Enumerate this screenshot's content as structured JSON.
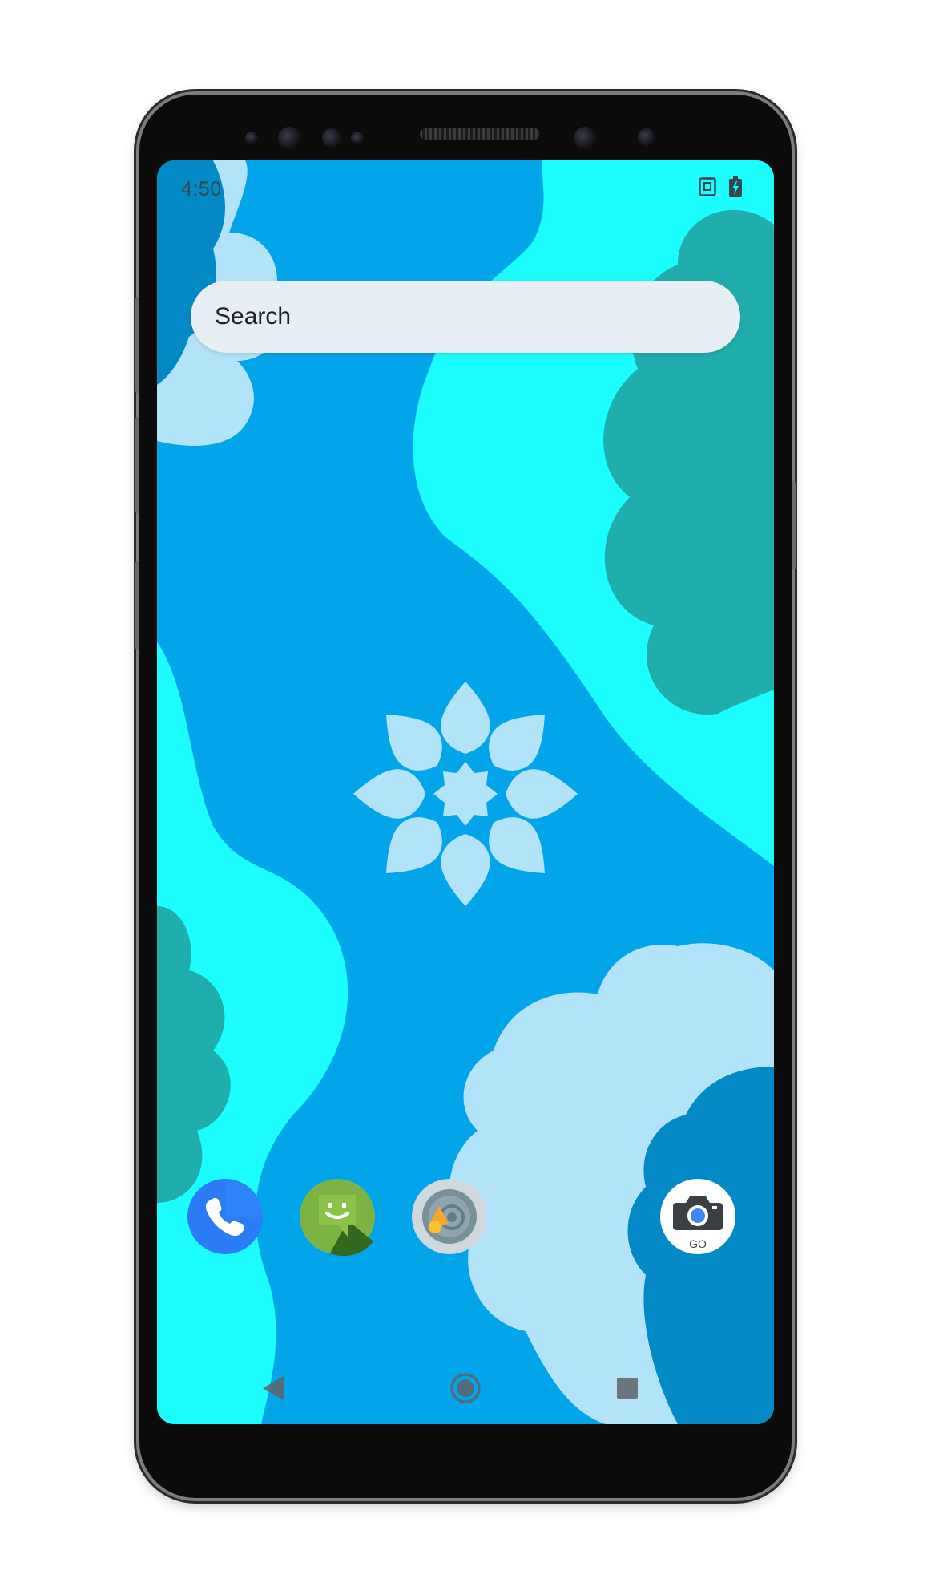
{
  "status_bar": {
    "time": "4:50",
    "icons": [
      "sim-icon",
      "battery-charging-icon"
    ]
  },
  "search": {
    "placeholder": "Search"
  },
  "dock": {
    "apps": [
      {
        "name": "phone-app",
        "icon": "phone-icon"
      },
      {
        "name": "messaging-app",
        "icon": "message-smile-icon"
      },
      {
        "name": "audio-recorder-app",
        "icon": "microphone-icon"
      },
      {
        "name": "camera-go-app",
        "icon": "camera-icon",
        "label": "GO"
      }
    ]
  },
  "navigation": {
    "buttons": [
      "back",
      "home",
      "recents"
    ]
  },
  "colors": {
    "wallpaper_base": "#02a5e9",
    "wallpaper_cyan": "#1cfdfd",
    "wallpaper_teal": "#20aead",
    "wallpaper_light": "#b3e3f8",
    "wallpaper_dark_blue": "#038ac6",
    "search_bg": "#e8eff4"
  }
}
